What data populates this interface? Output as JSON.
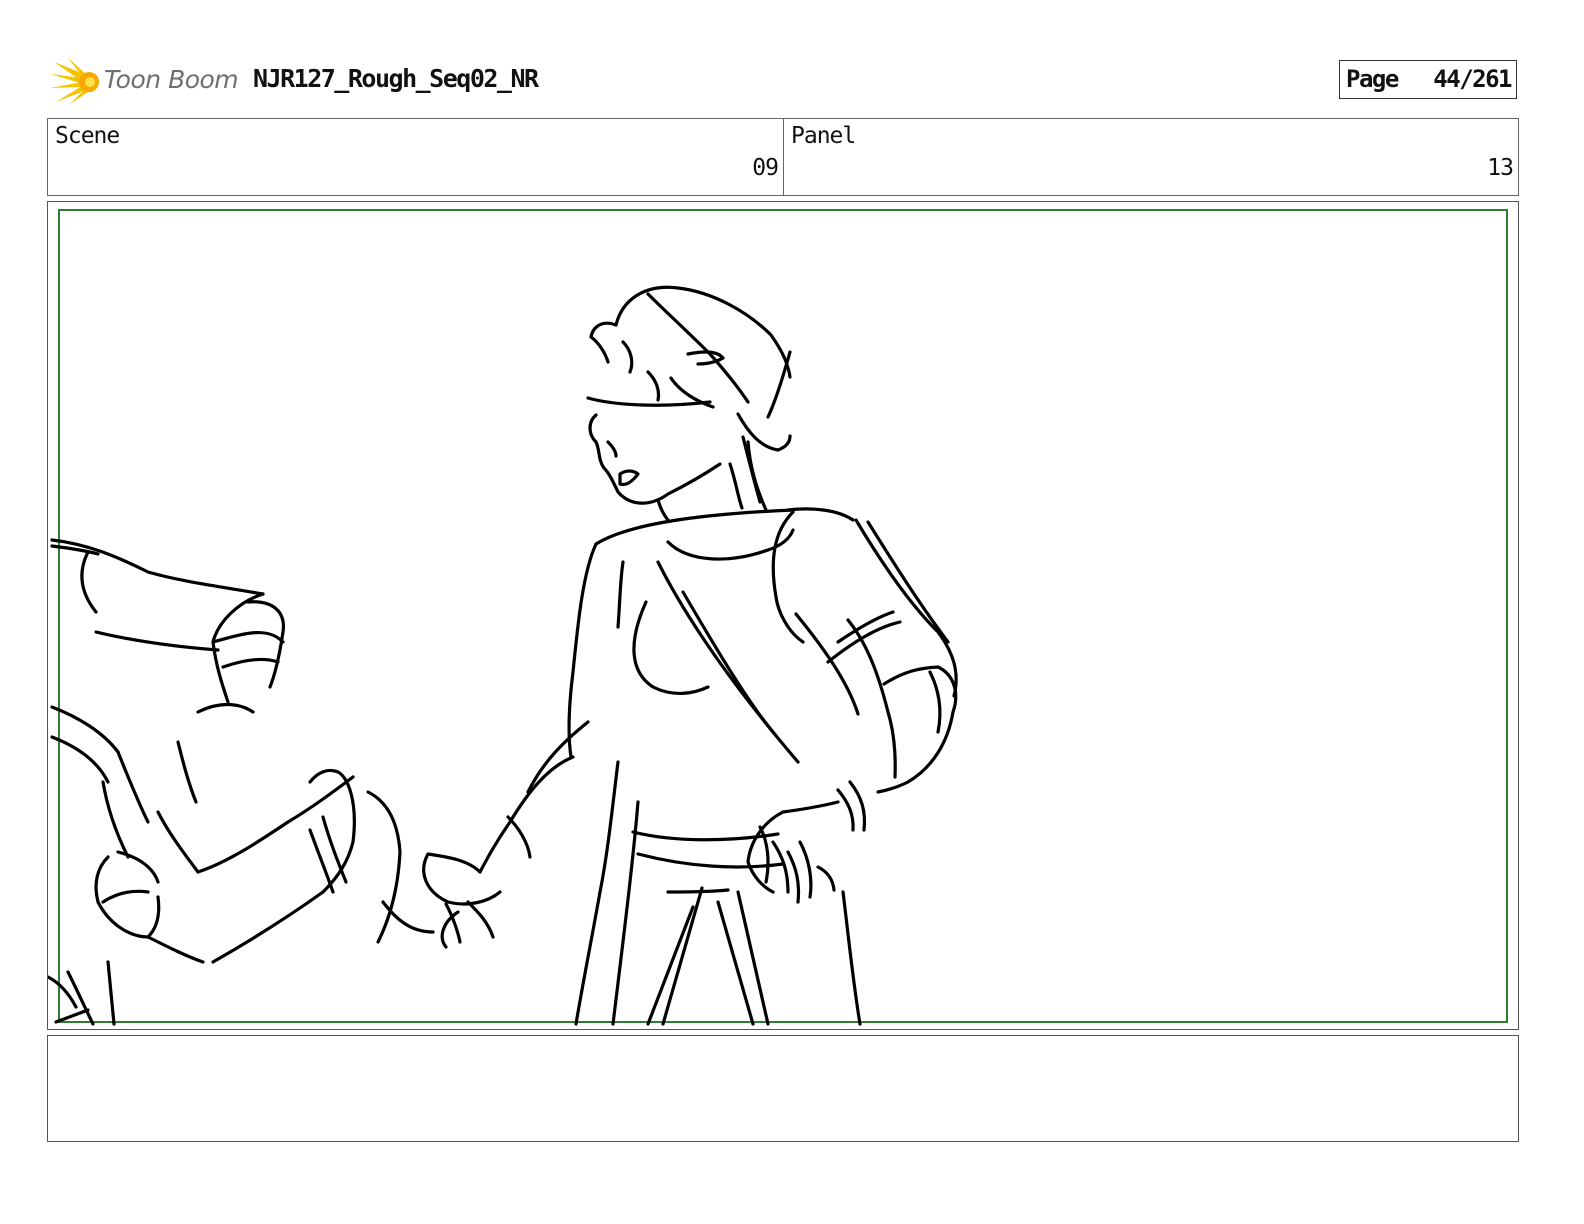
{
  "header": {
    "logo_text": "Toon Boom",
    "project_title": "NJR127_Rough_Seq02_NR",
    "page_label": "Page",
    "page_number": "44/261"
  },
  "info": {
    "scene_label": "Scene",
    "scene_value": "09",
    "panel_label": "Panel",
    "panel_value": "13"
  },
  "drawing": {
    "safe_area_color": "#2e7d32",
    "line_color": "#000000"
  },
  "notes": {
    "text": ""
  }
}
